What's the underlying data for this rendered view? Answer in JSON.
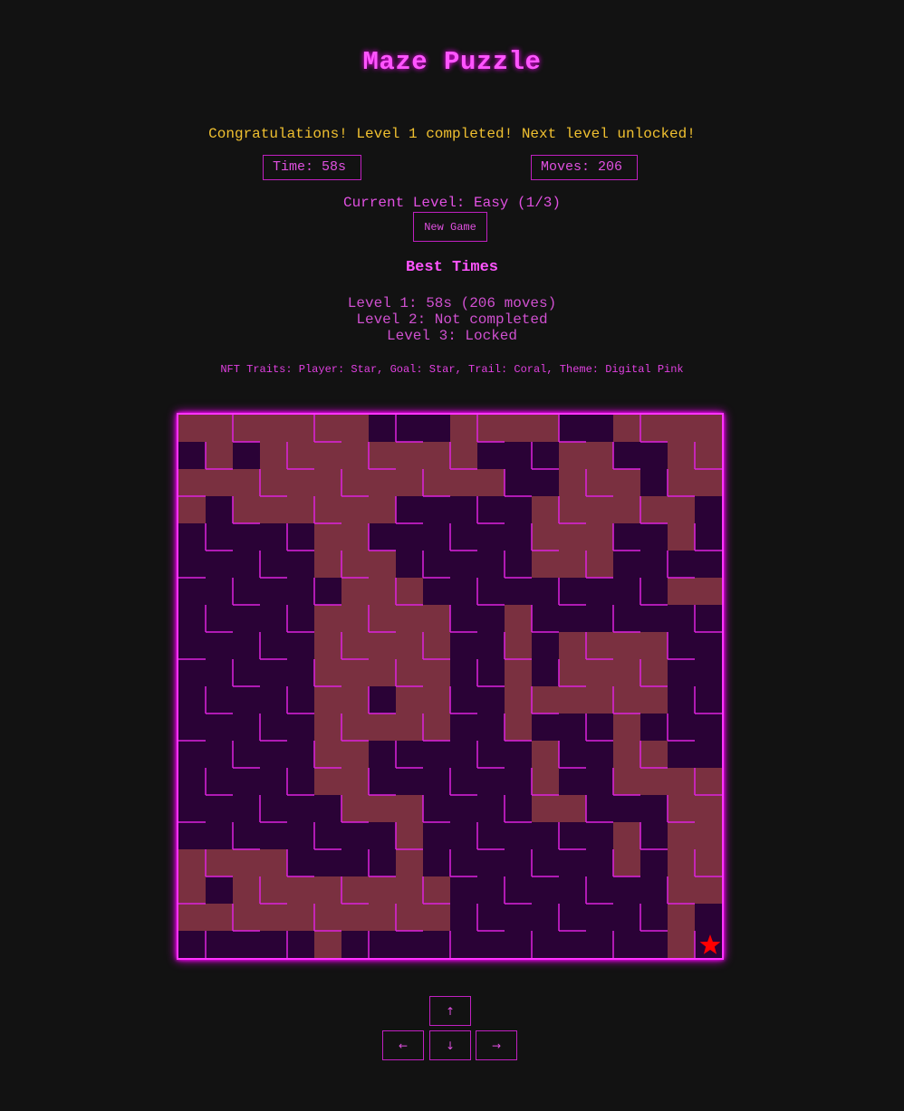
{
  "title": "Maze Puzzle",
  "message": "Congratulations! Level 1 completed! Next level unlocked!",
  "stats": {
    "time": "Time: 58s",
    "moves": "Moves: 206"
  },
  "current_level": "Current Level: Easy (1/3)",
  "new_game_label": "New Game",
  "best_times": {
    "title": "Best Times",
    "entries": [
      "Level 1: 58s (206 moves)",
      "Level 2: Not completed",
      "Level 3: Locked"
    ]
  },
  "traits": "NFT Traits: Player: Star, Goal: Star, Trail: Coral, Theme: Digital Pink",
  "controls": {
    "up": "↑",
    "left": "←",
    "down": "↓",
    "right": "→"
  },
  "colors": {
    "background": "#121212",
    "accent": "#ff33ff",
    "wall": "#dd22dd",
    "cell": "#2a0236",
    "trail": "#7a3040",
    "player": "#ff0000",
    "message": "#f0c030"
  },
  "maze": {
    "rows": 20,
    "cols": 20,
    "player_icon": "star-icon",
    "player_cell": [
      19,
      19
    ],
    "trail": [
      "111111100011110011111",
      "01011111111000110011",
      "11111111111100111011",
      "10111111000001111110",
      "00000110000001110010",
      "00000111000001110000",
      "00000011100000000011",
      "00000111110010000000",
      "00000111110010111100",
      "00000111110010111100",
      "00000110110011111100",
      "00000111110010001000",
      "00000110000001001100",
      "00000110000001001111",
      "00000011100001100011",
      "00000000100000001011",
      "11110000100000001011",
      "10111111110000000011",
      "11111111110000000010",
      "00000100000000000010"
    ]
  }
}
